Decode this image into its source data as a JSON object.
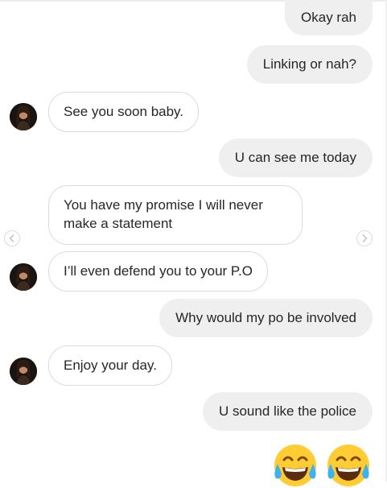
{
  "messages": [
    {
      "id": "m1",
      "direction": "outgoing",
      "text": "Okay rah"
    },
    {
      "id": "m2",
      "direction": "outgoing",
      "text": "Linking or nah?"
    },
    {
      "id": "m3",
      "direction": "incoming",
      "text": "See you soon baby.",
      "avatar": true
    },
    {
      "id": "m4",
      "direction": "outgoing",
      "text": "U can see me today"
    },
    {
      "id": "m5",
      "direction": "incoming",
      "text": "You have my promise I will never make a statement",
      "avatar": false
    },
    {
      "id": "m6",
      "direction": "incoming",
      "text": "I’ll even defend you to your P.O",
      "avatar": true
    },
    {
      "id": "m7",
      "direction": "outgoing",
      "text": "Why would my po be involved"
    },
    {
      "id": "m8",
      "direction": "incoming",
      "text": "Enjoy your day.",
      "avatar": true
    },
    {
      "id": "m9",
      "direction": "outgoing",
      "text": "U sound like the police"
    },
    {
      "id": "m10",
      "direction": "outgoing",
      "text": "😂😂"
    }
  ],
  "icons": {
    "prev": "chevron-left-icon",
    "next": "chevron-right-icon",
    "avatar": "contact-avatar",
    "emoji": "face-with-tears-of-joy-icon"
  },
  "colors": {
    "outgoing_bubble": "#efefef",
    "incoming_border": "#dbdbdb",
    "text": "#262626",
    "emoji_face": "#ffcc33"
  }
}
